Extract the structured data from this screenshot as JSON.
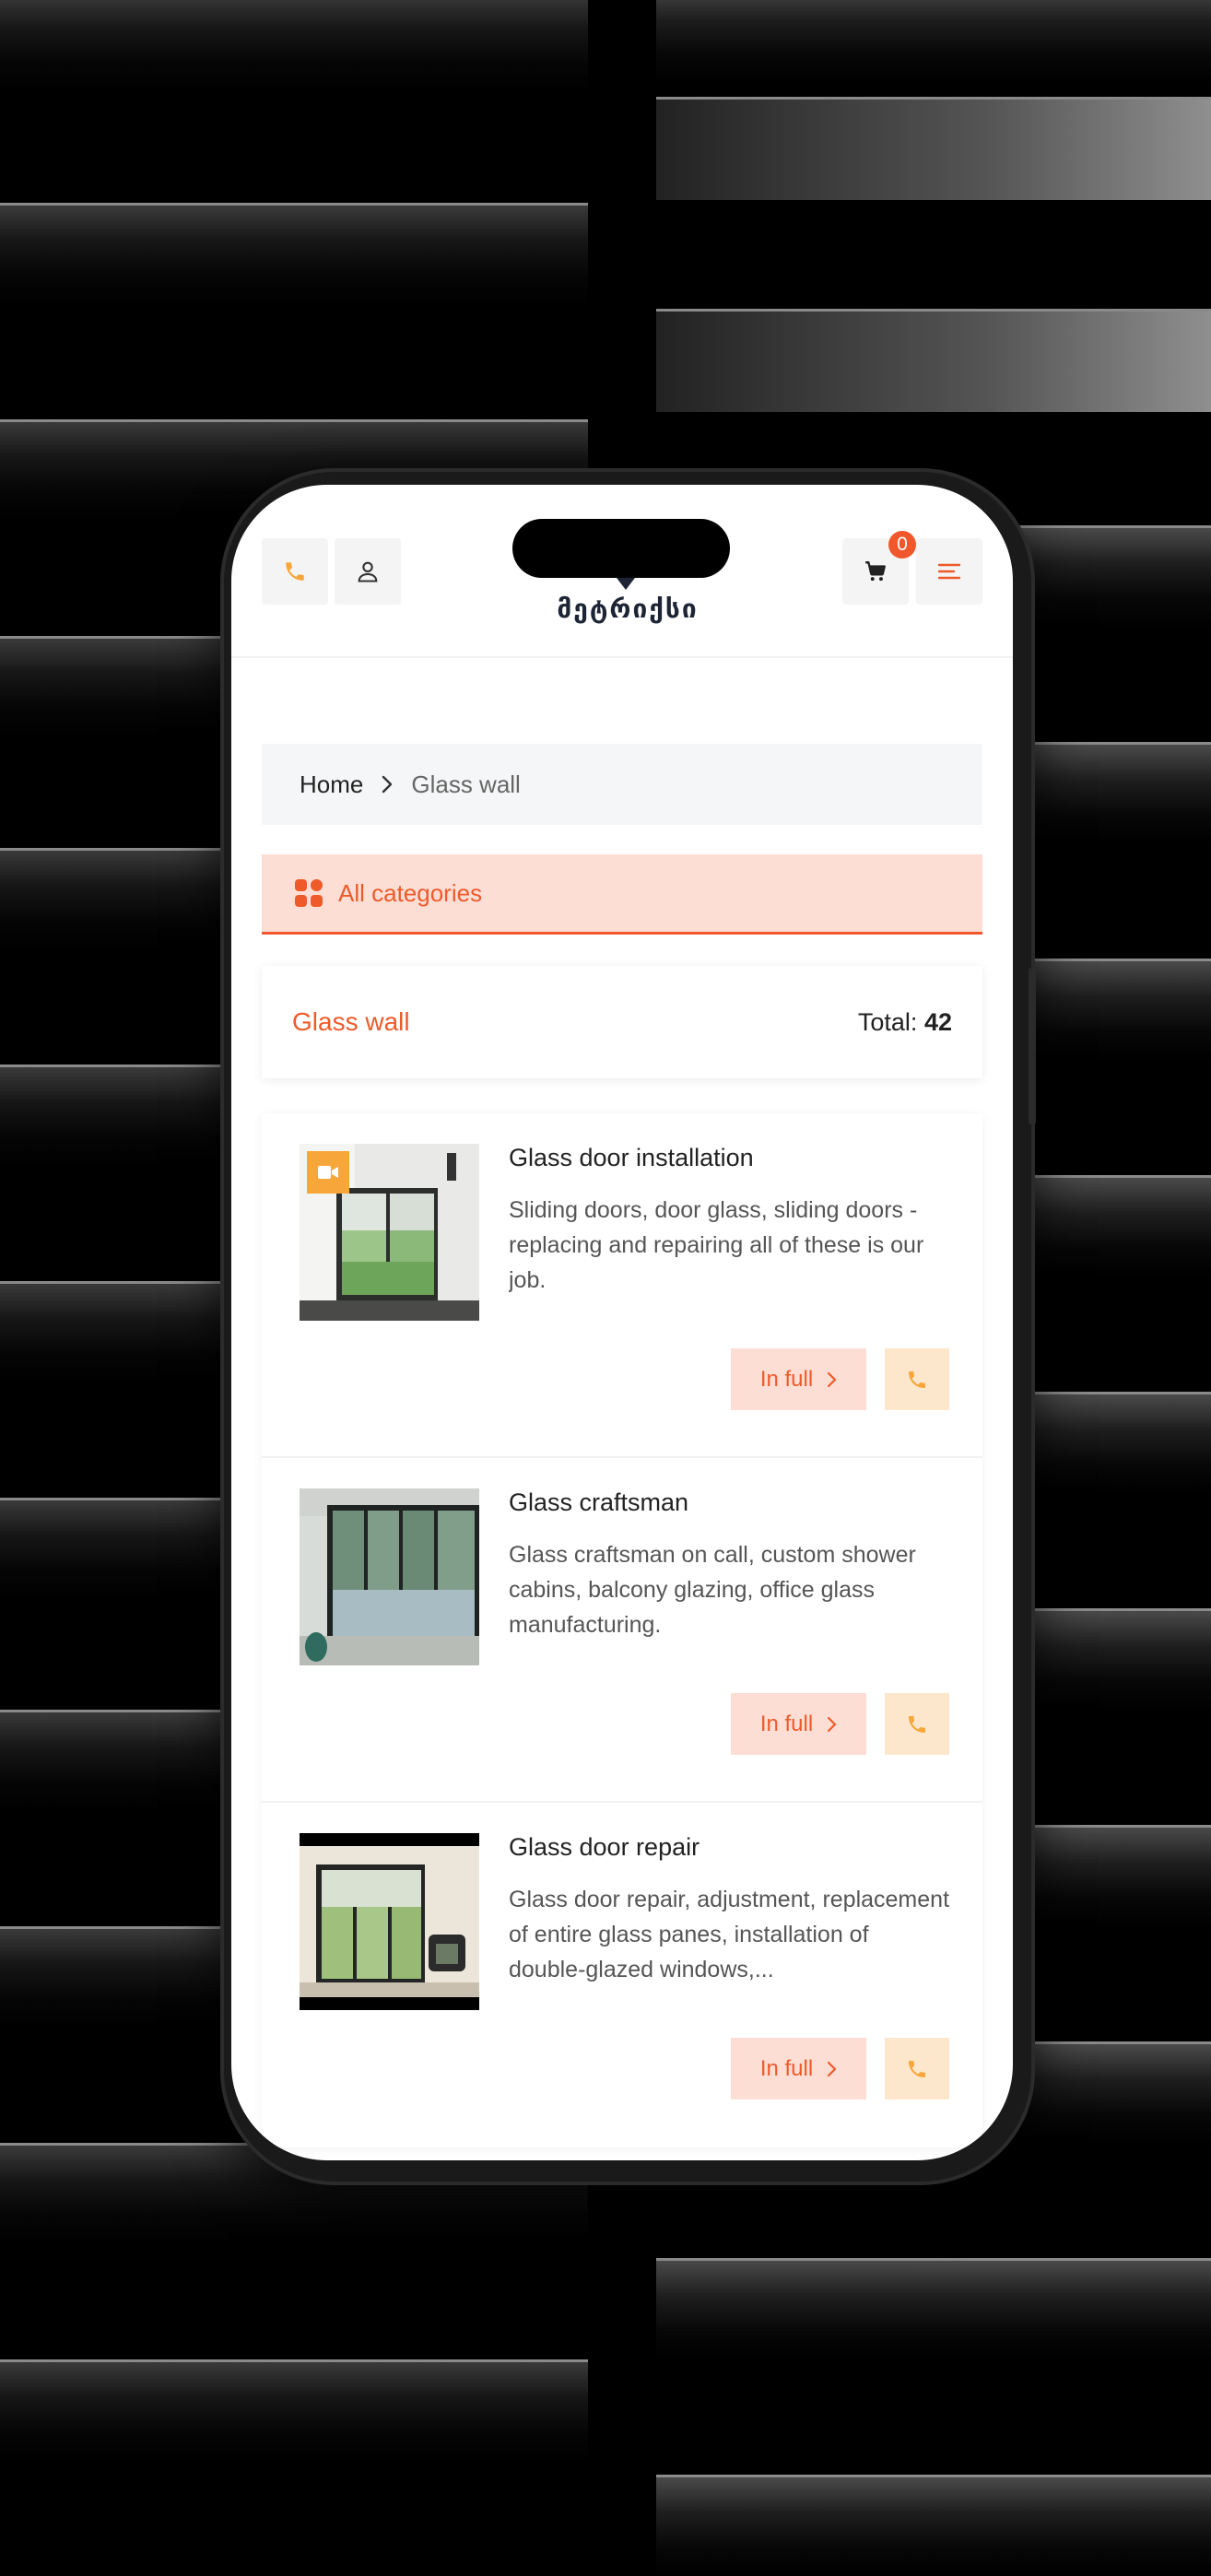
{
  "header": {
    "logo_text": "მეტრიქსი",
    "cart_count": "0"
  },
  "breadcrumb": {
    "home": "Home",
    "current": "Glass wall"
  },
  "categories": {
    "label": "All categories"
  },
  "listing_header": {
    "title": "Glass wall",
    "total_label": "Total:",
    "total_value": "42"
  },
  "items": [
    {
      "title": "Glass door installation",
      "description": "Sliding doors, door glass, sliding doors - replacing and repairing all of these is our job.",
      "button_label": "In full",
      "has_video": true
    },
    {
      "title": "Glass craftsman",
      "description": "Glass craftsman on call, custom shower cabins, balcony glazing, office glass manufacturing.",
      "button_label": "In full",
      "has_video": false
    },
    {
      "title": "Glass door repair",
      "description": "Glass door repair, adjustment, replacement of entire glass panes, installation of double-glazed windows,...",
      "button_label": "In full",
      "has_video": false
    }
  ],
  "colors": {
    "accent": "#ee5a2a",
    "accent_soft": "#fdded5",
    "phone_icon": "#f7a63a",
    "call_bg": "#fde7cc"
  },
  "icons": {
    "phone": "phone-icon",
    "user": "user-icon",
    "cart": "cart-icon",
    "menu": "menu-icon",
    "grid": "grid-icon",
    "chevron": "chevron-right-icon",
    "video": "video-icon"
  }
}
